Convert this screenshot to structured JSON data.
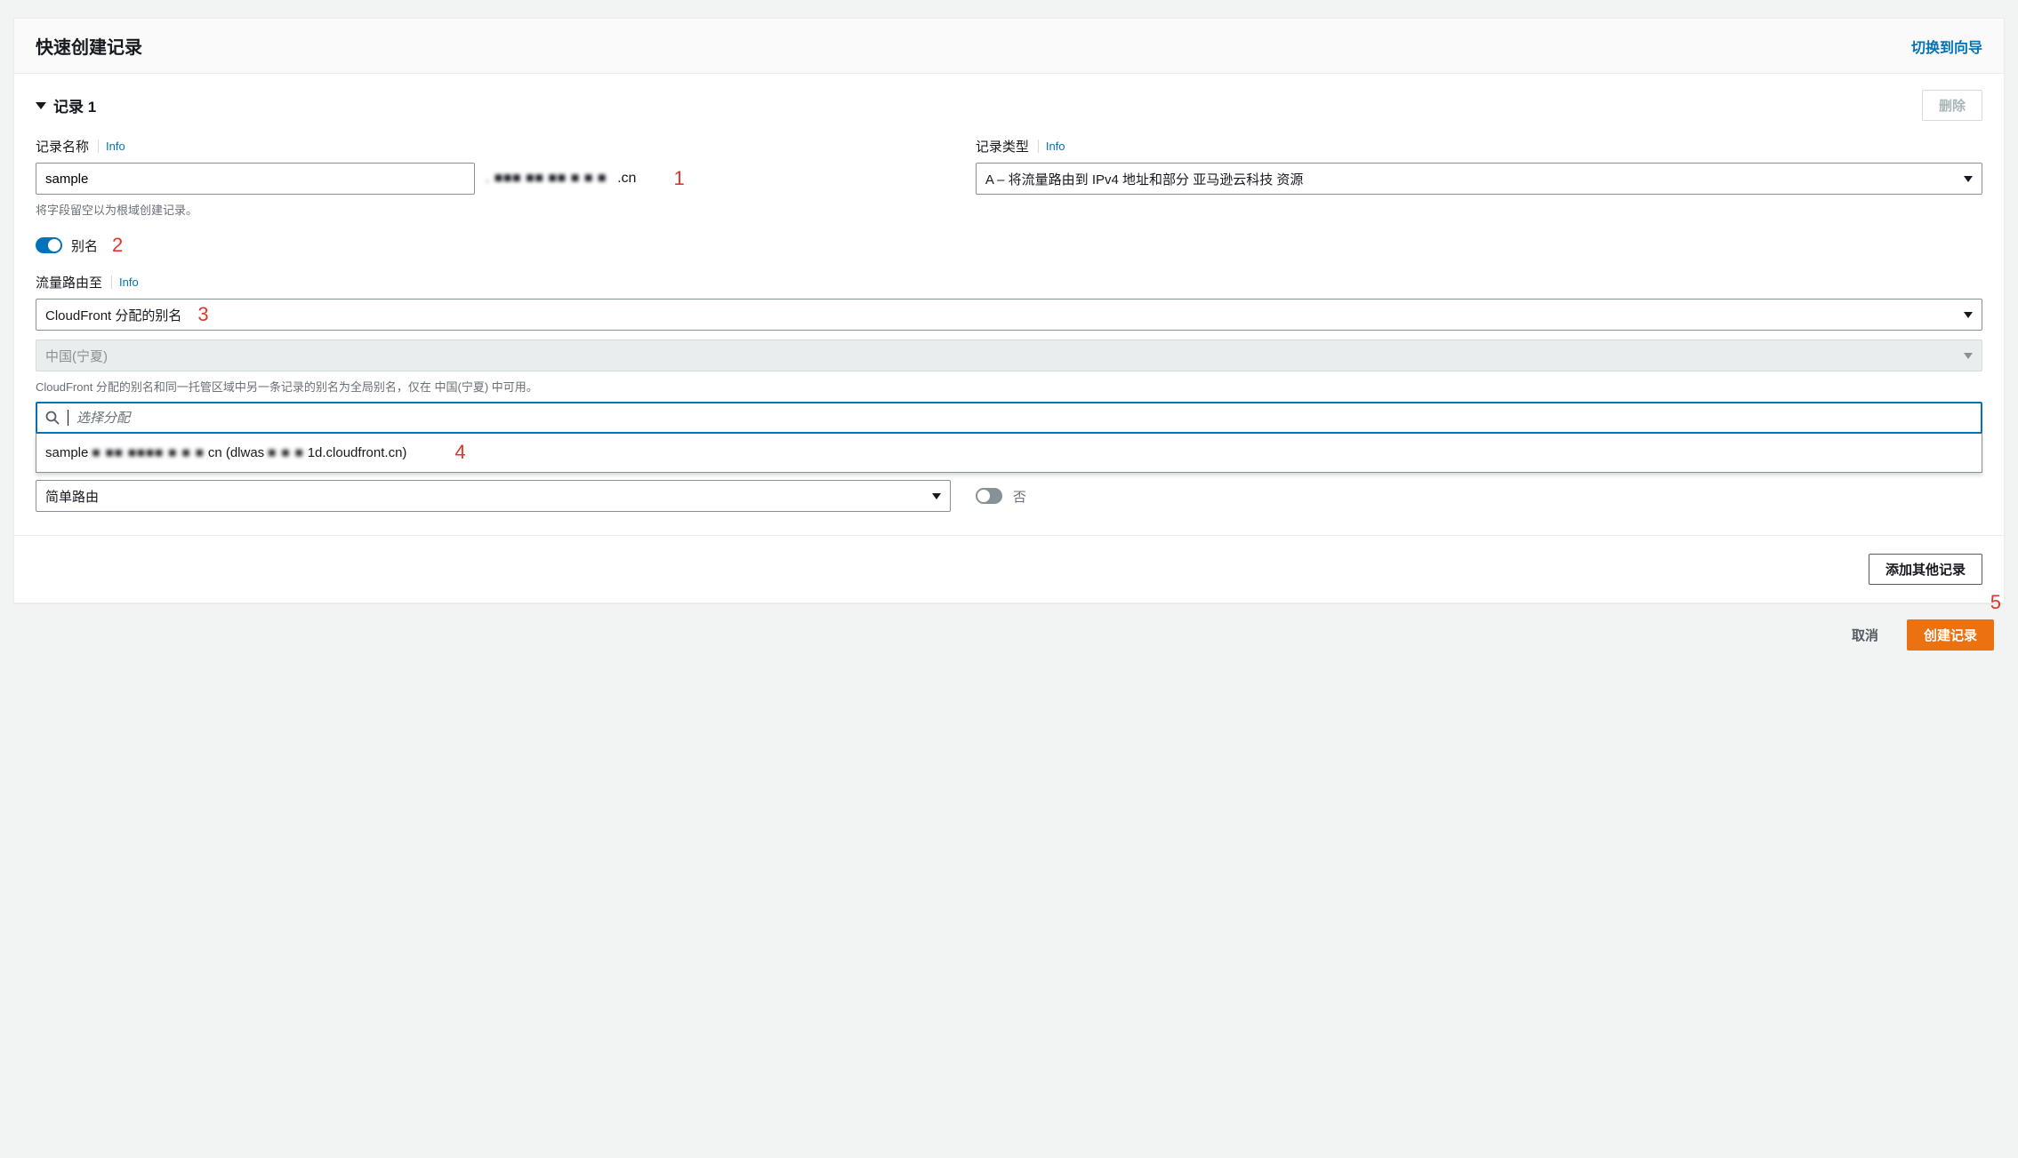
{
  "header": {
    "title": "快速创建记录",
    "switch_wizard": "切换到向导"
  },
  "record": {
    "section_title": "记录 1",
    "delete_label": "删除"
  },
  "record_name": {
    "label": "记录名称",
    "info": "Info",
    "value": "sample",
    "suffix_blur": ". ■■■ ■■ ■■ ■ ■ ■",
    "suffix_visible": ".cn",
    "helper": "将字段留空以为根域创建记录。"
  },
  "record_type": {
    "label": "记录类型",
    "info": "Info",
    "value": "A – 将流量路由到 IPv4 地址和部分 亚马逊云科技 资源"
  },
  "alias": {
    "label": "别名"
  },
  "route_to": {
    "label": "流量路由至",
    "info": "Info",
    "endpoint_value": "CloudFront 分配的别名",
    "region_value": "中国(宁夏)",
    "region_note": "CloudFront 分配的别名和同一托管区域中另一条记录的别名为全局别名，仅在 中国(宁夏) 中可用。",
    "search_placeholder": "选择分配",
    "option_prefix": "sample",
    "option_blur": "■ ■■ ■■■■ ■ ■ ■",
    "option_mid": "cn (dlwas",
    "option_blur2": "■ ■ ■",
    "option_suffix": "1d.cloudfront.cn)"
  },
  "routing_policy": {
    "value": "简单路由"
  },
  "evaluate": {
    "value": "否"
  },
  "footer_internal": {
    "add_another": "添加其他记录"
  },
  "page_footer": {
    "cancel": "取消",
    "create": "创建记录"
  },
  "annotations": {
    "a1": "1",
    "a2": "2",
    "a3": "3",
    "a4": "4",
    "a5": "5"
  }
}
